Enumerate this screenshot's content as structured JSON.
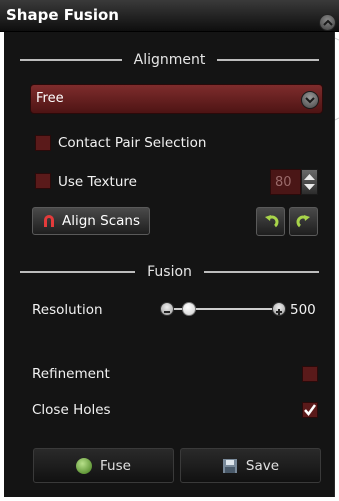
{
  "panel": {
    "title": "Shape Fusion"
  },
  "alignment": {
    "header": "Alignment",
    "mode_value": "Free",
    "contact_pair_label": "Contact Pair Selection",
    "contact_pair_checked": false,
    "use_texture_label": "Use Texture",
    "use_texture_checked": false,
    "texture_value": "80",
    "align_scans_label": "Align Scans"
  },
  "fusion": {
    "header": "Fusion",
    "resolution_label": "Resolution",
    "resolution_value": "500",
    "resolution_slider_fraction": 0.22,
    "refinement_label": "Refinement",
    "refinement_checked": false,
    "close_holes_label": "Close Holes",
    "close_holes_checked": true,
    "fuse_label": "Fuse",
    "save_label": "Save"
  },
  "colors": {
    "accent_red": "#7e2c2c",
    "panel_bg": "#141414"
  },
  "icons": [
    "chevron-up-icon",
    "chevron-down-icon",
    "magnet-icon",
    "undo-icon",
    "redo-icon",
    "minus-icon",
    "plus-icon",
    "checkmark-icon",
    "fuse-icon",
    "save-icon"
  ]
}
